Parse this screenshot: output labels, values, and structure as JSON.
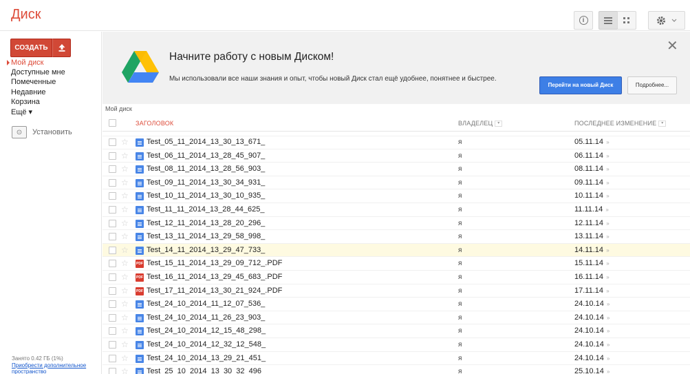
{
  "app": {
    "title": "Диск"
  },
  "toolbar": {
    "info_icon": "info-icon",
    "list_icon": "list-view-icon",
    "grid_icon": "grid-view-icon",
    "settings_icon": "gear-icon"
  },
  "sidebar": {
    "create_label": "СОЗДАТЬ",
    "nav": [
      {
        "label": "Мой диск",
        "active": true
      },
      {
        "label": "Доступные мне"
      },
      {
        "label": "Помеченные"
      },
      {
        "label": "Недавние"
      },
      {
        "label": "Корзина"
      },
      {
        "label": "Ещё ▾"
      }
    ],
    "install_label": "Установить",
    "storage_used": "Занято 0.42 ГБ (1%)",
    "storage_link": "Приобрести дополнительное пространство"
  },
  "promo": {
    "title": "Начните работу с новым Диском!",
    "text": "Мы использовали все наши знания и опыт, чтобы новый Диск стал ещё удобнее, понятнее и быстрее.",
    "switch_label": "Перейти на новый Диск",
    "more_label": "Подробнее..."
  },
  "list": {
    "breadcrumb": "Мой диск",
    "headers": {
      "title": "ЗАГОЛОВОК",
      "owner": "ВЛАДЕЛЕЦ",
      "modified": "ПОСЛЕДНЕЕ ИЗМЕНЕНИЕ"
    },
    "rows": [
      {
        "name": "Test_05_11_2014_13_30_13_671_",
        "type": "doc",
        "owner": "я",
        "modified": "05.11.14"
      },
      {
        "name": "Test_06_11_2014_13_28_45_907_",
        "type": "doc",
        "owner": "я",
        "modified": "06.11.14"
      },
      {
        "name": "Test_08_11_2014_13_28_56_903_",
        "type": "doc",
        "owner": "я",
        "modified": "08.11.14"
      },
      {
        "name": "Test_09_11_2014_13_30_34_931_",
        "type": "doc",
        "owner": "я",
        "modified": "09.11.14"
      },
      {
        "name": "Test_10_11_2014_13_30_10_935_",
        "type": "doc",
        "owner": "я",
        "modified": "10.11.14"
      },
      {
        "name": "Test_11_11_2014_13_28_44_625_",
        "type": "doc",
        "owner": "я",
        "modified": "11.11.14"
      },
      {
        "name": "Test_12_11_2014_13_28_20_296_",
        "type": "doc",
        "owner": "я",
        "modified": "12.11.14"
      },
      {
        "name": "Test_13_11_2014_13_29_58_998_",
        "type": "doc",
        "owner": "я",
        "modified": "13.11.14"
      },
      {
        "name": "Test_14_11_2014_13_29_47_733_",
        "type": "doc",
        "owner": "я",
        "modified": "14.11.14",
        "highlight": true
      },
      {
        "name": "Test_15_11_2014_13_29_09_712_.PDF",
        "type": "pdf",
        "owner": "я",
        "modified": "15.11.14"
      },
      {
        "name": "Test_16_11_2014_13_29_45_683_.PDF",
        "type": "pdf",
        "owner": "я",
        "modified": "16.11.14"
      },
      {
        "name": "Test_17_11_2014_13_30_21_924_.PDF",
        "type": "pdf",
        "owner": "я",
        "modified": "17.11.14"
      },
      {
        "name": "Test_24_10_2014_11_12_07_536_",
        "type": "doc",
        "owner": "я",
        "modified": "24.10.14"
      },
      {
        "name": "Test_24_10_2014_11_26_23_903_",
        "type": "doc",
        "owner": "я",
        "modified": "24.10.14"
      },
      {
        "name": "Test_24_10_2014_12_15_48_298_",
        "type": "doc",
        "owner": "я",
        "modified": "24.10.14"
      },
      {
        "name": "Test_24_10_2014_12_32_12_548_",
        "type": "doc",
        "owner": "я",
        "modified": "24.10.14"
      },
      {
        "name": "Test_24_10_2014_13_29_21_451_",
        "type": "doc",
        "owner": "я",
        "modified": "24.10.14"
      },
      {
        "name": "Test_25_10_2014_13_30_32_496",
        "type": "doc",
        "owner": "я",
        "modified": "25.10.14"
      }
    ]
  },
  "colors": {
    "accent": "#dd4b39",
    "primary_button": "#3d7fe6",
    "highlight_row": "#fefae1"
  }
}
